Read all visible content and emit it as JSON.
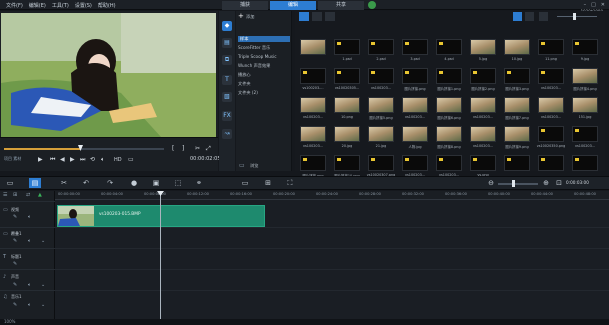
{
  "menu": [
    "文件(F)",
    "编辑(E)",
    "工具(T)",
    "设置(S)",
    "帮助(H)"
  ],
  "mode_tabs": [
    "捕获",
    "编辑",
    "共享"
  ],
  "resolution": "1920*1080",
  "player": {
    "timecode": "00:00:02:05",
    "mode_label": "项目 素材",
    "hd_label": "HD"
  },
  "library": {
    "add_label": "添加",
    "tree": [
      "样本",
      "ScoreFitter 音乐",
      "Triple Scoop Music",
      "Wunch 声音效果",
      "播放心",
      "文件夹",
      "文件夹 (2)"
    ],
    "browse_label": "浏览",
    "items": [
      {
        "label": "",
        "kind": "photo"
      },
      {
        "label": "1.psd",
        "kind": "black"
      },
      {
        "label": "2.psd",
        "kind": "black"
      },
      {
        "label": "3.psd",
        "kind": "black"
      },
      {
        "label": "4.psd",
        "kind": "black"
      },
      {
        "label": "5.jpg",
        "kind": "photo"
      },
      {
        "label": "10.jpg",
        "kind": "photo"
      },
      {
        "label": "11.png",
        "kind": "black"
      },
      {
        "label": "9.jpg",
        "kind": "black"
      },
      {
        "label": "vs100203-...",
        "kind": "black"
      },
      {
        "label": "vs10020305...",
        "kind": "black"
      },
      {
        "label": "vs100203...",
        "kind": "black"
      },
      {
        "label": "图片拼接.png",
        "kind": "black"
      },
      {
        "label": "图片拼接1.png",
        "kind": "black"
      },
      {
        "label": "图片拼接2.png",
        "kind": "black"
      },
      {
        "label": "图片拼接3.png",
        "kind": "black"
      },
      {
        "label": "vs100203...",
        "kind": "black"
      },
      {
        "label": "图片拼接4.png",
        "kind": "photo"
      },
      {
        "label": "vs100203...",
        "kind": "photo"
      },
      {
        "label": "10.png",
        "kind": "photo"
      },
      {
        "label": "图片拼接5.png",
        "kind": "photo"
      },
      {
        "label": "vs100203...",
        "kind": "photo"
      },
      {
        "label": "图片拼接6.png",
        "kind": "photo"
      },
      {
        "label": "vs100203...",
        "kind": "photo"
      },
      {
        "label": "图片拼接7.png",
        "kind": "photo"
      },
      {
        "label": "vs100203...",
        "kind": "photo"
      },
      {
        "label": "151.jpg",
        "kind": "photo"
      },
      {
        "label": "vs100203...",
        "kind": "photo"
      },
      {
        "label": "20.jpg",
        "kind": "photo"
      },
      {
        "label": "21.jpg",
        "kind": "photo"
      },
      {
        "label": "人物.jpg",
        "kind": "photo"
      },
      {
        "label": "图片拼接8.png",
        "kind": "photo"
      },
      {
        "label": "vs100203...",
        "kind": "photo"
      },
      {
        "label": "图片拼接9.png",
        "kind": "photo"
      },
      {
        "label": "vs10020350.png",
        "kind": "black"
      },
      {
        "label": "vs100203...",
        "kind": "black"
      },
      {
        "label": "图片拼接.png",
        "kind": "black"
      },
      {
        "label": "图片拼接10.png",
        "kind": "black"
      },
      {
        "label": "vs10020307.png",
        "kind": "black"
      },
      {
        "label": "vs100203...",
        "kind": "black"
      },
      {
        "label": "vs100203...",
        "kind": "black"
      },
      {
        "label": "vs.png",
        "kind": "black"
      },
      {
        "label": "",
        "kind": "black"
      },
      {
        "label": "",
        "kind": "black"
      },
      {
        "label": "",
        "kind": "black"
      },
      {
        "label": "",
        "kind": "black"
      },
      {
        "label": "",
        "kind": "black"
      },
      {
        "label": "",
        "kind": "black"
      },
      {
        "label": "",
        "kind": "black"
      },
      {
        "label": "",
        "kind": "black"
      }
    ]
  },
  "timeline": {
    "timecode": "0:00:03:00",
    "ruler": [
      "00:00:00:00",
      "00:00:04:00",
      "00:00:08:00",
      "00:00:12:00",
      "00:00:16:00",
      "00:00:20:00",
      "00:00:24:00",
      "00:00:28:00",
      "00:00:32:00",
      "00:00:36:00",
      "00:00:40:00",
      "00:00:44:00",
      "00:00:48:00"
    ],
    "tracks": [
      "视频",
      "覆叠1",
      "标题1",
      "声音",
      "音乐1"
    ],
    "clip_label": "vs100203-015.BMP"
  },
  "status_left": "100%",
  "colors": {
    "accent": "#2d7dd2",
    "clip": "#1e8a6e",
    "badge": "#e8c531"
  }
}
